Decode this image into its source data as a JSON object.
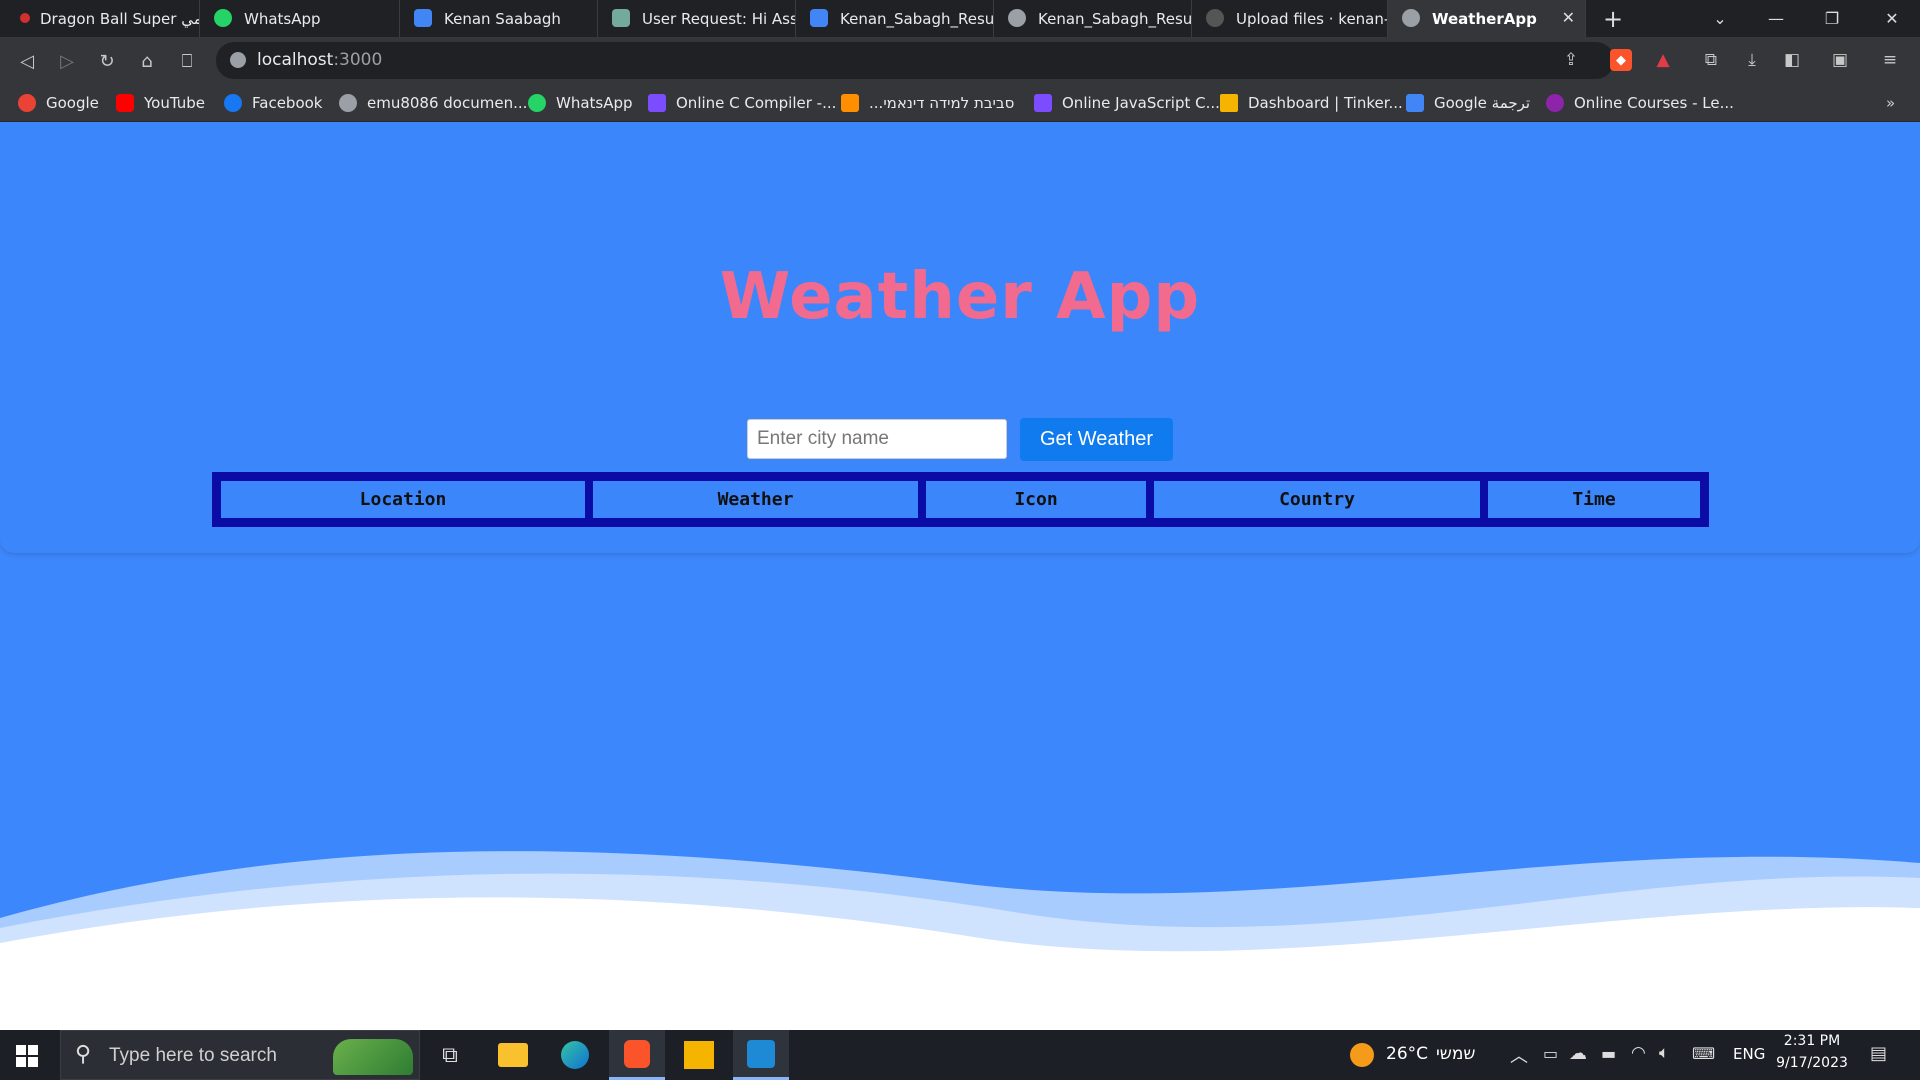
{
  "browser": {
    "tabs": [
      {
        "label": "Dragon Ball Super أنمي",
        "color": "#d32f2f"
      },
      {
        "label": "WhatsApp",
        "color": "#25d366"
      },
      {
        "label": "Kenan Saabagh",
        "color": "#4285f4"
      },
      {
        "label": "User Request: Hi Assist",
        "color": "#74aa9c"
      },
      {
        "label": "Kenan_Sabagh_Resume",
        "color": "#4285f4"
      },
      {
        "label": "Kenan_Sabagh_Resume",
        "color": "#9aa0a6"
      },
      {
        "label": "Upload files · kenan-sa",
        "color": "#9aa0a6"
      },
      {
        "label": "WeatherApp",
        "color": "#9aa0a6"
      }
    ],
    "url": "localhost",
    "url_port": ":3000",
    "bookmarks": [
      {
        "label": "Google",
        "color": "#ea4335"
      },
      {
        "label": "YouTube",
        "color": "#ff0000"
      },
      {
        "label": "Facebook",
        "color": "#1877f2"
      },
      {
        "label": "emu8086 documen...",
        "color": "#9aa0a6"
      },
      {
        "label": "WhatsApp",
        "color": "#25d366"
      },
      {
        "label": "Online C Compiler -...",
        "color": "#7c4dff"
      },
      {
        "label": "...סביבת למידה דינאמי",
        "color": "#ff8f00"
      },
      {
        "label": "Online JavaScript C...",
        "color": "#7c4dff"
      },
      {
        "label": "Dashboard | Tinker...",
        "color": "#f4b400"
      },
      {
        "label": "Google ترجمة",
        "color": "#4285f4"
      },
      {
        "label": "Online Courses - Le...",
        "color": "#8e24aa"
      }
    ]
  },
  "app": {
    "title": "Weather App",
    "input_placeholder": "Enter city name",
    "button_label": "Get Weather",
    "columns": [
      "Location",
      "Weather",
      "Icon",
      "Country",
      "Time"
    ]
  },
  "taskbar": {
    "search_placeholder": "Type here to search",
    "weather": "26°C",
    "weather_desc": "שמשי",
    "language": "ENG",
    "time": "2:31 PM",
    "date": "9/17/2023"
  },
  "colors": {
    "page_bg": "#3d87fc",
    "title": "#f26b8e",
    "button": "#0f7bef",
    "table_border": "#0b0ba6"
  }
}
